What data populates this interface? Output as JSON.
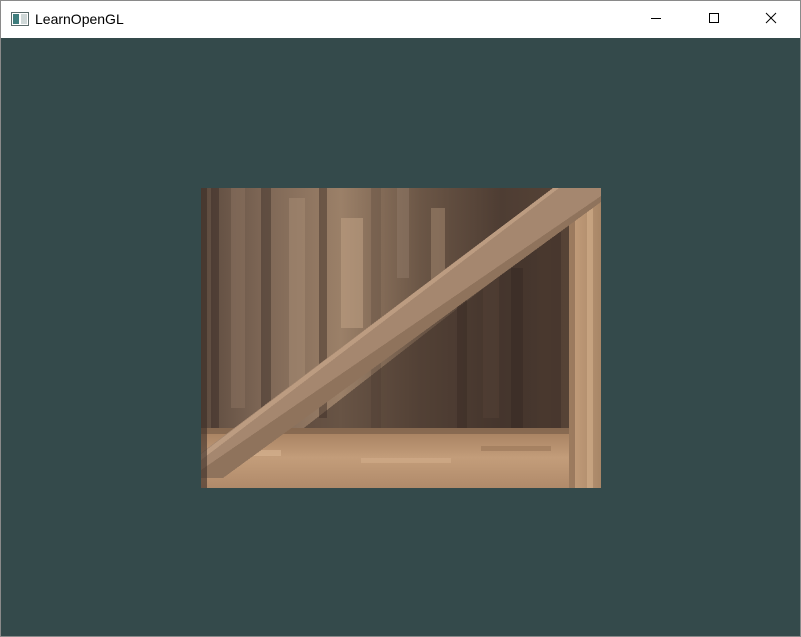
{
  "window": {
    "title": "LearnOpenGL",
    "app_icon": "window-app-icon",
    "controls": {
      "minimize_icon": "minimize-icon",
      "maximize_icon": "maximize-icon",
      "close_icon": "close-icon"
    }
  },
  "viewport": {
    "clear_color": "#344a4b",
    "texture": {
      "subject": "wooden-crate-texture",
      "colors": {
        "dark_wood": "#4e3d32",
        "mid_wood": "#8d7462",
        "light_wood": "#c6a382",
        "plank": "#b08d72"
      }
    }
  }
}
